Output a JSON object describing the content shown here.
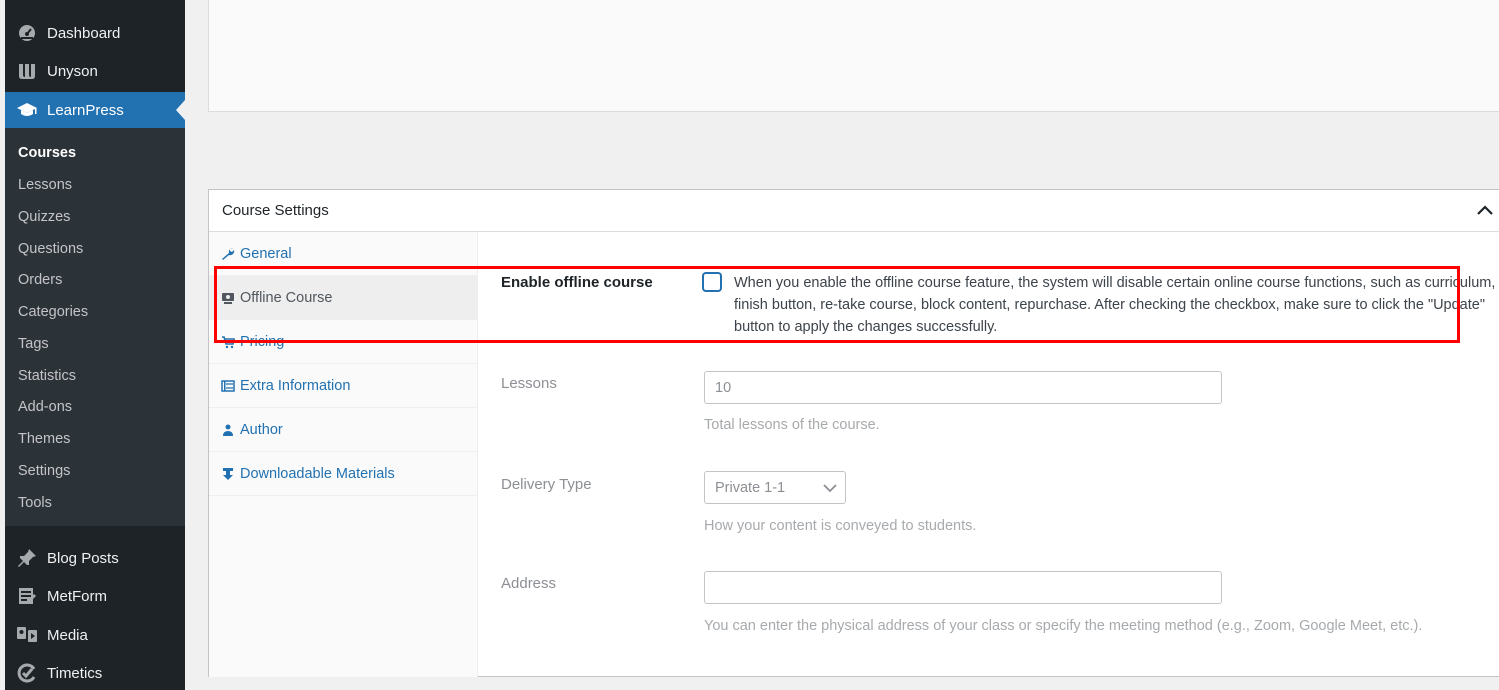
{
  "sidebar": {
    "top_items": [
      {
        "label": "Dashboard",
        "icon": "dashboard-icon"
      },
      {
        "label": "Unyson",
        "icon": "unyson-icon"
      },
      {
        "label": "LearnPress",
        "icon": "graduation-cap-icon"
      }
    ],
    "submenu": [
      "Courses",
      "Lessons",
      "Quizzes",
      "Questions",
      "Orders",
      "Categories",
      "Tags",
      "Statistics",
      "Add-ons",
      "Themes",
      "Settings",
      "Tools"
    ],
    "bottom_items": [
      {
        "label": "Blog Posts",
        "icon": "pin-icon"
      },
      {
        "label": "MetForm",
        "icon": "form-icon"
      },
      {
        "label": "Media",
        "icon": "media-icon"
      },
      {
        "label": "Timetics",
        "icon": "timetics-icon"
      }
    ]
  },
  "panel": {
    "title": "Course Settings",
    "tabs": [
      "General",
      "Offline Course",
      "Pricing",
      "Extra Information",
      "Author",
      "Downloadable Materials"
    ],
    "active_tab": "Offline Course"
  },
  "fields": {
    "enable_offline": {
      "label": "Enable offline course",
      "description": "When you enable the offline course feature, the system will disable certain online course functions, such as curriculum, finish button, re-take course, block content, repurchase. After checking the checkbox, make sure to click the \"Update\" button to apply the changes successfully."
    },
    "lessons": {
      "label": "Lessons",
      "value": "10",
      "description": "Total lessons of the course."
    },
    "delivery_type": {
      "label": "Delivery Type",
      "value": "Private 1-1",
      "description": "How your content is conveyed to students."
    },
    "address": {
      "label": "Address",
      "value": "",
      "description": "You can enter the physical address of your class or specify the meeting method (e.g., Zoom, Google Meet, etc.)."
    }
  },
  "colors": {
    "accent": "#2271b1",
    "sidebar_bg": "#1d2327",
    "highlight": "#ff0000"
  }
}
